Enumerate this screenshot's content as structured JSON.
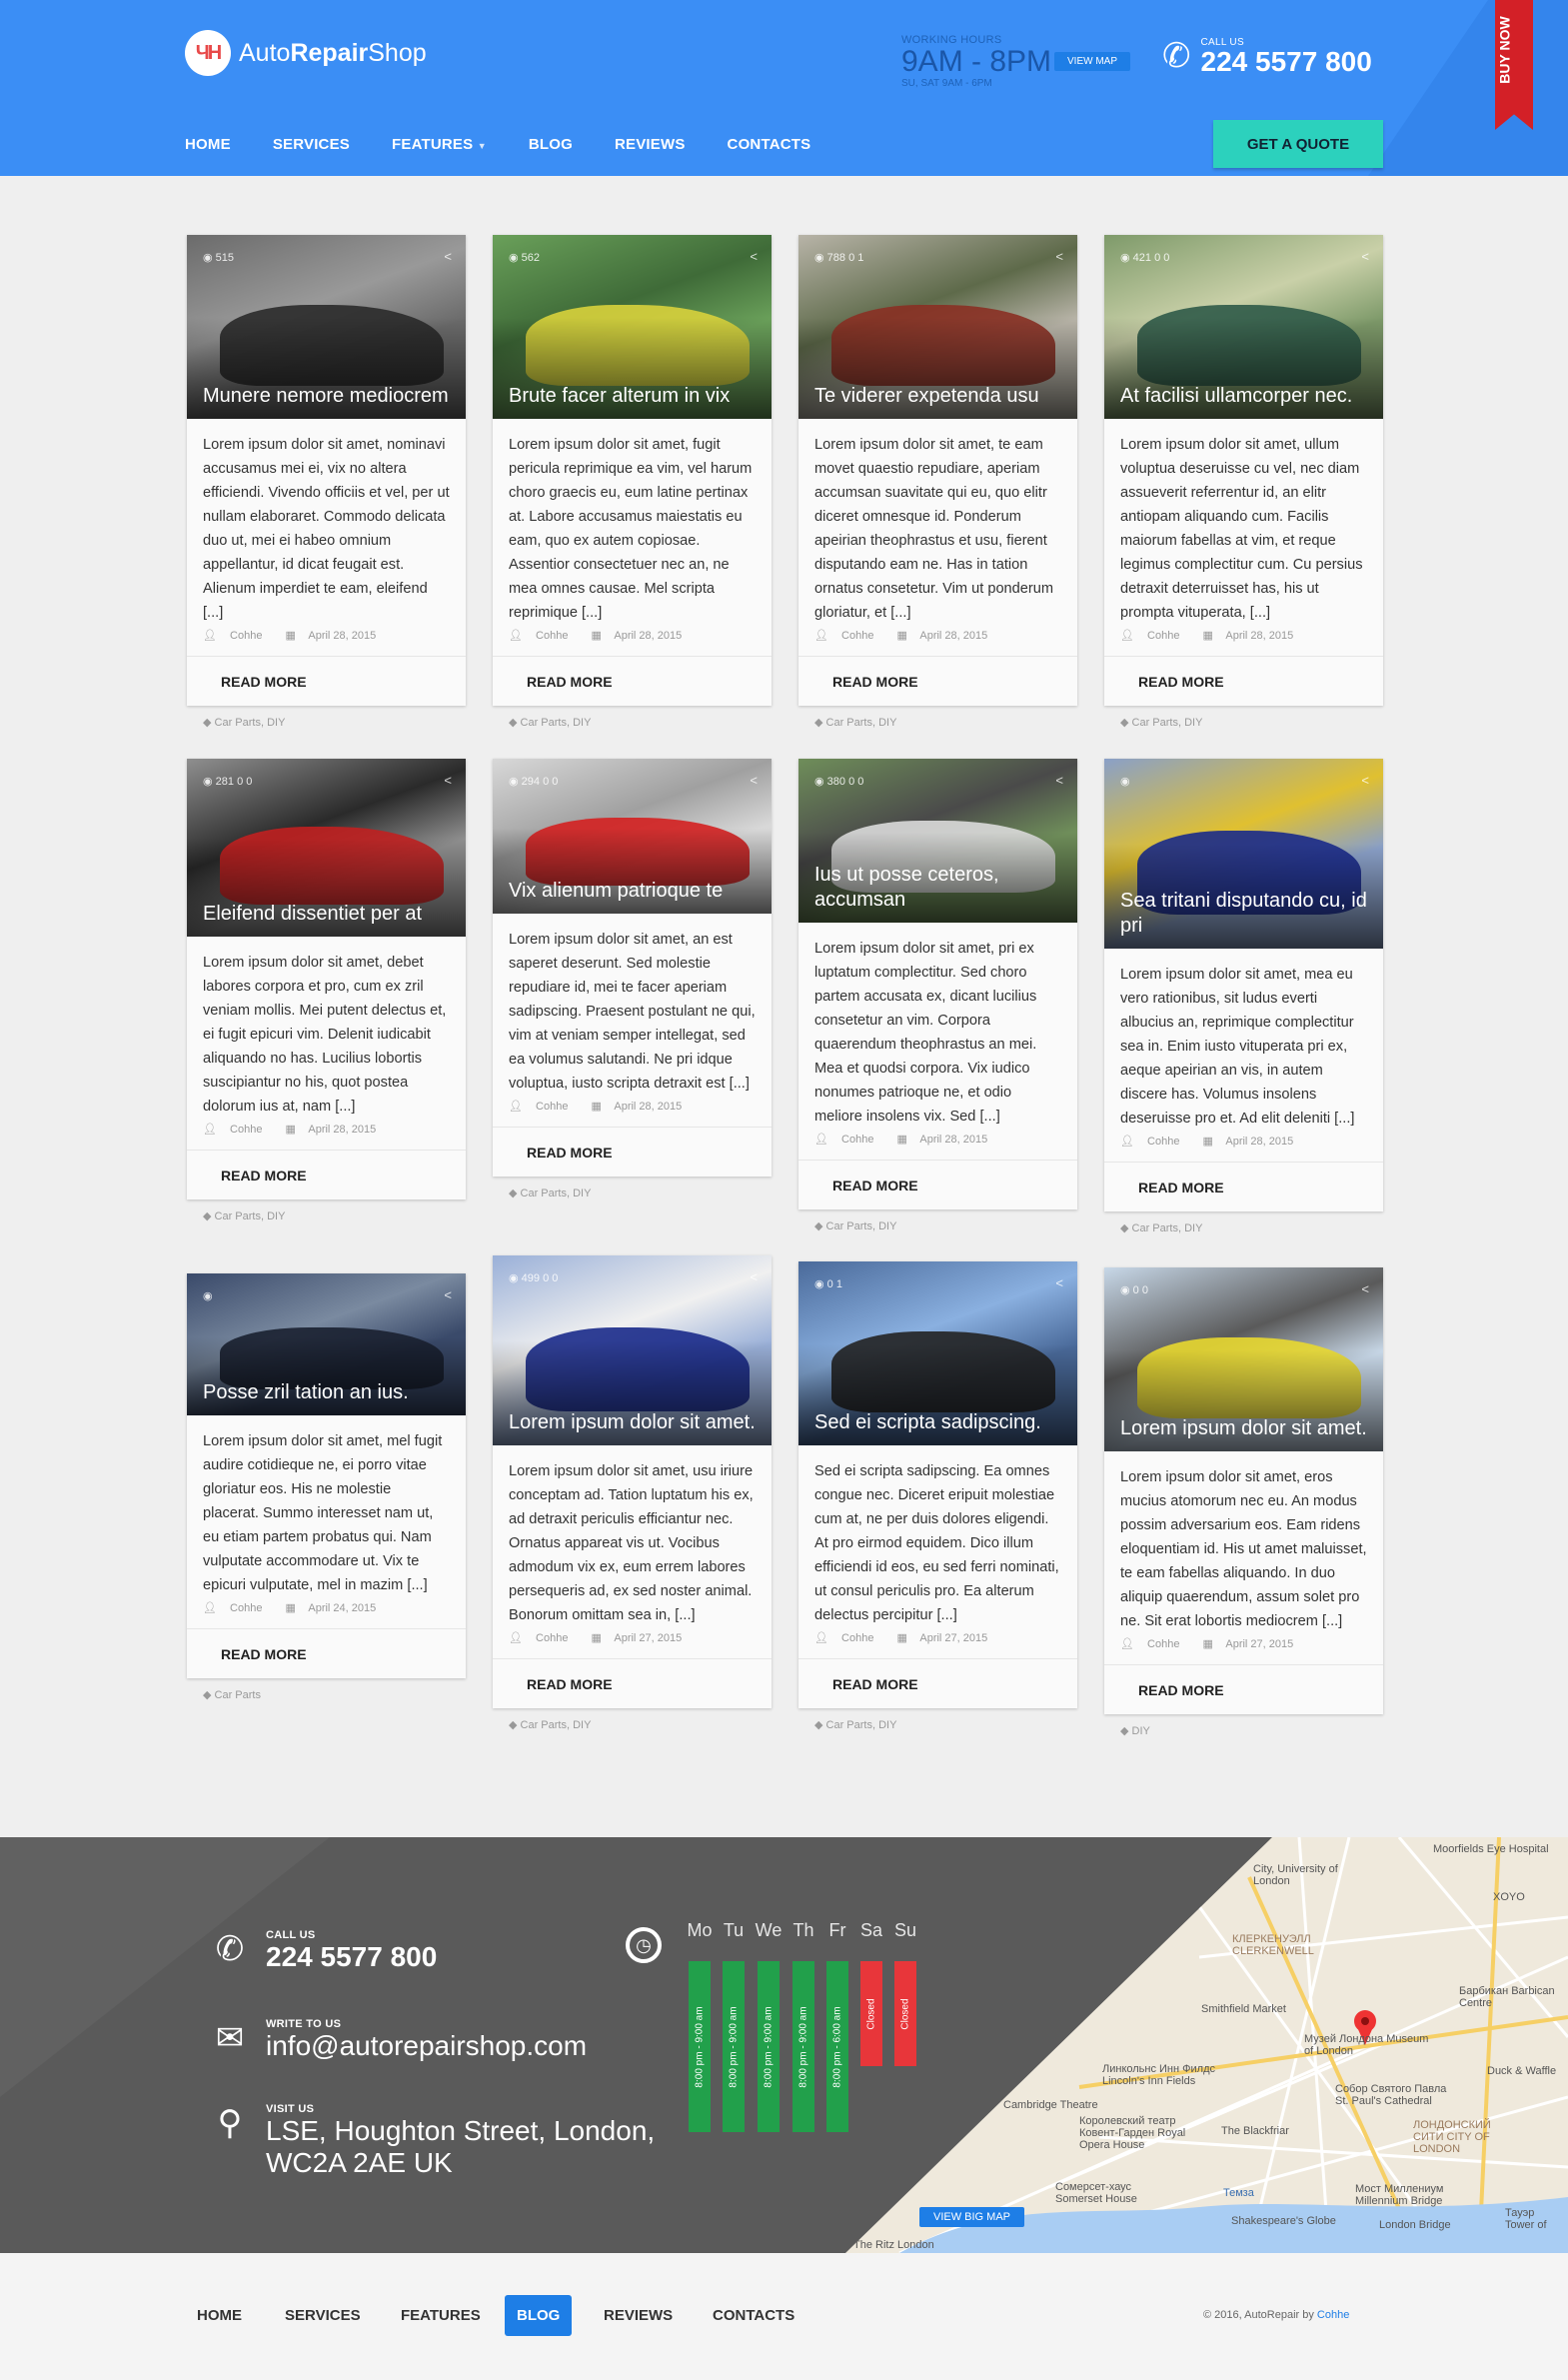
{
  "header": {
    "logo_text_light": "Auto",
    "logo_text_bold": "Repair",
    "logo_text_end": "Shop",
    "hours_label": "WORKING HOURS",
    "hours_main": "9AM - 8PM",
    "hours_sub": "SU, SAT 9AM - 6PM",
    "view_map": "VIEW MAP",
    "call_label": "CALL US",
    "call_number": "224 5577 800",
    "buy_now": "BUY NOW",
    "nav": [
      "HOME",
      "SERVICES",
      "FEATURES",
      "BLOG",
      "REVIEWS",
      "CONTACTS"
    ],
    "quote": "GET A QUOTE",
    "colors": {
      "primary": "#3b8ef5",
      "accent": "#2cd1bd",
      "active": "#e8475a"
    }
  },
  "posts": [
    {
      "title": "Munere nemore mediocrem",
      "stats": "515",
      "body": "Lorem ipsum dolor sit amet, nominavi accusamus mei ei, vix no altera efficiendi. Vivendo officiis et vel, per ut nullam elaboraret. Commodo delicata duo ut, mei ei habeo omnium appellantur, id dicat feugait est. Alienum imperdiet te eam, eleifend [...]",
      "author": "Cohhe",
      "date": "April 28, 2015",
      "read": "READ MORE",
      "tags": "Car Parts, DIY"
    },
    {
      "title": "Brute facer alterum in vix",
      "stats": "562",
      "body": "Lorem ipsum dolor sit amet, fugit pericula reprimique ea vim, vel harum choro graecis eu, eum latine pertinax at. Labore accusamus maiestatis eu eam, quo ex autem copiosae. Assentior consectetuer nec an, ne mea omnes causae. Mel scripta reprimique [...]",
      "author": "Cohhe",
      "date": "April 28, 2015",
      "read": "READ MORE",
      "tags": "Car Parts, DIY"
    },
    {
      "title": "Te viderer expetenda usu",
      "stats": "788   0   1",
      "body": "Lorem ipsum dolor sit amet, te eam movet quaestio repudiare, aperiam accumsan suavitate qui eu, quo elitr diceret omnesque id. Ponderum apeirian theophrastus et usu, fierent disputando eam ne. Has in tation ornatus consetetur. Vim ut ponderum gloriatur, et [...]",
      "author": "Cohhe",
      "date": "April 28, 2015",
      "read": "READ MORE",
      "tags": "Car Parts, DIY"
    },
    {
      "title": "At facilisi ullamcorper nec.",
      "stats": "421   0   0",
      "body": "Lorem ipsum dolor sit amet, ullum voluptua deseruisse cu vel, nec diam assueverit referrentur id, an elitr antiopam aliquando cum. Facilis maiorum fabellas at vim, et reque legimus complectitur cum. Cu persius detraxit deterruisset has, his ut prompta vituperata, [...]",
      "author": "Cohhe",
      "date": "April 28, 2015",
      "read": "READ MORE",
      "tags": "Car Parts, DIY"
    },
    {
      "title": "Eleifend dissentiet per at",
      "stats": "281   0   0",
      "body": "Lorem ipsum dolor sit amet, debet labores corpora et pro, cum ex zril veniam mollis. Mei putent delectus et, ei fugit epicuri vim. Delenit iudicabit aliquando no has. Lucilius lobortis suscipiantur no his, quot postea dolorum ius at, nam [...]",
      "author": "Cohhe",
      "date": "April 28, 2015",
      "read": "READ MORE",
      "tags": "Car Parts, DIY"
    },
    {
      "title": "Vix alienum patrioque te",
      "stats": "294   0   0",
      "body": "Lorem ipsum dolor sit amet, an est saperet deserunt. Sed molestie repudiare id, mei te facer aperiam sadipscing. Praesent postulant ne qui, vim at veniam semper intellegat, sed ea volumus salutandi. Ne pri idque voluptua, iusto scripta detraxit est [...]",
      "author": "Cohhe",
      "date": "April 28, 2015",
      "read": "READ MORE",
      "tags": "Car Parts, DIY"
    },
    {
      "title": "Ius ut posse ceteros, accumsan",
      "stats": "380   0   0",
      "body": "Lorem ipsum dolor sit amet, pri ex luptatum complectitur. Sed choro partem accusata ex, dicant lucilius consetetur an vim. Corpora quaerendum theophrastus an mei. Mea et quodsi corpora. Vix iudico nonumes patrioque ne, et odio meliore insolens vix. Sed [...]",
      "author": "Cohhe",
      "date": "April 28, 2015",
      "read": "READ MORE",
      "tags": "Car Parts, DIY"
    },
    {
      "title": "Sea tritani disputando cu, id pri",
      "stats": "",
      "body": "Lorem ipsum dolor sit amet, mea eu vero rationibus, sit ludus everti albucius an, reprimique complectitur sea in. Enim iusto vituperata pri ex, aeque apeirian an vis, in autem discere has. Volumus insolens deseruisse pro et. Ad elit deleniti [...]",
      "author": "Cohhe",
      "date": "April 28, 2015",
      "read": "READ MORE",
      "tags": "Car Parts, DIY"
    },
    {
      "title": "Posse zril tation an ius.",
      "stats": "",
      "body": "Lorem ipsum dolor sit amet, mel fugit audire cotidieque ne, ei porro vitae gloriatur eos. His ne molestie placerat. Summo interesset nam ut, eu etiam partem probatus qui. Nam vulputate accommodare ut. Vix te epicuri vulputate, mel in mazim [...]",
      "author": "Cohhe",
      "date": "April 24, 2015",
      "read": "READ MORE",
      "tags": "Car Parts"
    },
    {
      "title": "Lorem ipsum dolor sit amet.",
      "stats": "499   0   0",
      "body": "Lorem ipsum dolor sit amet, usu iriure conceptam ad. Tation luptatum his ex, ad detraxit periculis efficiantur nec. Ornatus appareat vis ut. Vocibus admodum vix ex, eum errem labores persequeris ad, ex sed noster animal. Bonorum omittam sea in, [...]",
      "author": "Cohhe",
      "date": "April 27, 2015",
      "read": "READ MORE",
      "tags": "Car Parts, DIY"
    },
    {
      "title": "Sed ei scripta sadipscing.",
      "stats": "0   1",
      "body": "Sed ei scripta sadipscing. Ea omnes congue nec. Diceret eripuit molestiae cum at, ne per duis dolores eligendi. At pro eirmod equidem. Dico illum efficiendi id eos, eu sed ferri nominati, ut consul periculis pro. Ea alterum delectus percipitur [...]",
      "author": "Cohhe",
      "date": "April 27, 2015",
      "read": "READ MORE",
      "tags": "Car Parts, DIY"
    },
    {
      "title": "Lorem ipsum dolor sit amet.",
      "stats": "0   0",
      "body": "Lorem ipsum dolor sit amet, eros mucius atomorum nec eu. An modus possim adversarium eos. Eam ridens eloquentiam id. His ut amet maluisset, te eam fabellas aliquando. In duo aliquip quaerendum, assum solet pro ne. Sit erat lobortis mediocrem [...]",
      "author": "Cohhe",
      "date": "April 27, 2015",
      "read": "READ MORE",
      "tags": "DIY"
    }
  ],
  "contact": {
    "call_label": "CALL US",
    "call_value": "224 5577 800",
    "write_label": "WRITE TO US",
    "write_value": "info@autorepairshop.com",
    "visit_label": "VISIT US",
    "visit_line1": "LSE, Houghton Street, London,",
    "visit_line2": "WC2A 2AE UK",
    "days": [
      "Mo",
      "Tu",
      "We",
      "Th",
      "Fr",
      "Sa",
      "Su"
    ],
    "hours": [
      "8:00 pm - 9:00 am",
      "8:00 pm - 9:00 am",
      "8:00 pm - 9:00 am",
      "8:00 pm - 9:00 am",
      "8:00 pm - 6:00 am",
      "Closed",
      "Closed"
    ],
    "open_color": "#22a04b",
    "closed_color": "#e8363a",
    "view_big_map": "VIEW BIG MAP",
    "map_labels": [
      "Moorfields Eye Hospital",
      "City, University of London",
      "XOYO",
      "КЛЕРКЕНУЭЛЛ CLERKENWELL",
      "Барбикан Barbican Centre",
      "Smithfield Market",
      "Музей Лондона Museum of London",
      "Линкольнс Инн Филдс Lincoln's Inn Fields",
      "Duck & Waffle",
      "Собор Святого Павла St. Paul's Cathedral",
      "Cambridge Theatre",
      "Королевский театр Ковент-Гарден Royal Opera House",
      "The Blackfriar",
      "ЛОНДОНСКИЙ СИТИ CITY OF LONDON",
      "Сомерсет-хаус Somerset House",
      "Мост Миллениум Millennium Bridge",
      "Темза",
      "Shakespeare's Globe",
      "London Bridge",
      "Тауэр Tower of",
      "The Ritz London"
    ]
  },
  "bottom_nav": {
    "items": [
      "HOME",
      "SERVICES",
      "FEATURES",
      "BLOG",
      "REVIEWS",
      "CONTACTS"
    ],
    "copyright": "© 2016, AutoRepair by ",
    "copyright_link": "Cohhe"
  }
}
